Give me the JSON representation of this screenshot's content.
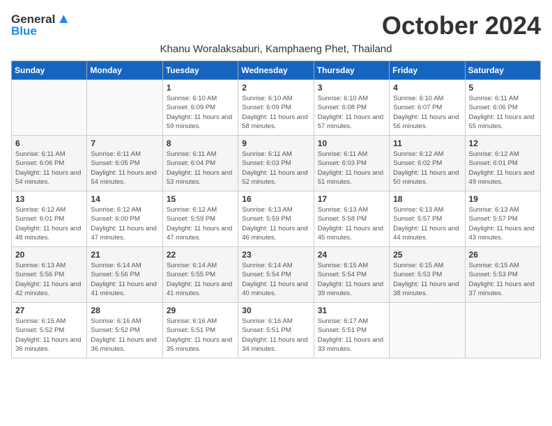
{
  "header": {
    "logo_general": "General",
    "logo_blue": "Blue",
    "month_title": "October 2024",
    "subtitle": "Khanu Woralaksaburi, Kamphaeng Phet, Thailand"
  },
  "weekdays": [
    "Sunday",
    "Monday",
    "Tuesday",
    "Wednesday",
    "Thursday",
    "Friday",
    "Saturday"
  ],
  "weeks": [
    [
      {
        "day": "",
        "sunrise": "",
        "sunset": "",
        "daylight": ""
      },
      {
        "day": "",
        "sunrise": "",
        "sunset": "",
        "daylight": ""
      },
      {
        "day": "1",
        "sunrise": "Sunrise: 6:10 AM",
        "sunset": "Sunset: 6:09 PM",
        "daylight": "Daylight: 11 hours and 59 minutes."
      },
      {
        "day": "2",
        "sunrise": "Sunrise: 6:10 AM",
        "sunset": "Sunset: 6:09 PM",
        "daylight": "Daylight: 11 hours and 58 minutes."
      },
      {
        "day": "3",
        "sunrise": "Sunrise: 6:10 AM",
        "sunset": "Sunset: 6:08 PM",
        "daylight": "Daylight: 11 hours and 57 minutes."
      },
      {
        "day": "4",
        "sunrise": "Sunrise: 6:10 AM",
        "sunset": "Sunset: 6:07 PM",
        "daylight": "Daylight: 11 hours and 56 minutes."
      },
      {
        "day": "5",
        "sunrise": "Sunrise: 6:11 AM",
        "sunset": "Sunset: 6:06 PM",
        "daylight": "Daylight: 11 hours and 55 minutes."
      }
    ],
    [
      {
        "day": "6",
        "sunrise": "Sunrise: 6:11 AM",
        "sunset": "Sunset: 6:06 PM",
        "daylight": "Daylight: 11 hours and 54 minutes."
      },
      {
        "day": "7",
        "sunrise": "Sunrise: 6:11 AM",
        "sunset": "Sunset: 6:05 PM",
        "daylight": "Daylight: 11 hours and 54 minutes."
      },
      {
        "day": "8",
        "sunrise": "Sunrise: 6:11 AM",
        "sunset": "Sunset: 6:04 PM",
        "daylight": "Daylight: 11 hours and 53 minutes."
      },
      {
        "day": "9",
        "sunrise": "Sunrise: 6:11 AM",
        "sunset": "Sunset: 6:03 PM",
        "daylight": "Daylight: 11 hours and 52 minutes."
      },
      {
        "day": "10",
        "sunrise": "Sunrise: 6:11 AM",
        "sunset": "Sunset: 6:03 PM",
        "daylight": "Daylight: 11 hours and 51 minutes."
      },
      {
        "day": "11",
        "sunrise": "Sunrise: 6:12 AM",
        "sunset": "Sunset: 6:02 PM",
        "daylight": "Daylight: 11 hours and 50 minutes."
      },
      {
        "day": "12",
        "sunrise": "Sunrise: 6:12 AM",
        "sunset": "Sunset: 6:01 PM",
        "daylight": "Daylight: 11 hours and 49 minutes."
      }
    ],
    [
      {
        "day": "13",
        "sunrise": "Sunrise: 6:12 AM",
        "sunset": "Sunset: 6:01 PM",
        "daylight": "Daylight: 11 hours and 48 minutes."
      },
      {
        "day": "14",
        "sunrise": "Sunrise: 6:12 AM",
        "sunset": "Sunset: 6:00 PM",
        "daylight": "Daylight: 11 hours and 47 minutes."
      },
      {
        "day": "15",
        "sunrise": "Sunrise: 6:12 AM",
        "sunset": "Sunset: 5:59 PM",
        "daylight": "Daylight: 11 hours and 47 minutes."
      },
      {
        "day": "16",
        "sunrise": "Sunrise: 6:13 AM",
        "sunset": "Sunset: 5:59 PM",
        "daylight": "Daylight: 11 hours and 46 minutes."
      },
      {
        "day": "17",
        "sunrise": "Sunrise: 6:13 AM",
        "sunset": "Sunset: 5:58 PM",
        "daylight": "Daylight: 11 hours and 45 minutes."
      },
      {
        "day": "18",
        "sunrise": "Sunrise: 6:13 AM",
        "sunset": "Sunset: 5:57 PM",
        "daylight": "Daylight: 11 hours and 44 minutes."
      },
      {
        "day": "19",
        "sunrise": "Sunrise: 6:13 AM",
        "sunset": "Sunset: 5:57 PM",
        "daylight": "Daylight: 11 hours and 43 minutes."
      }
    ],
    [
      {
        "day": "20",
        "sunrise": "Sunrise: 6:13 AM",
        "sunset": "Sunset: 5:56 PM",
        "daylight": "Daylight: 11 hours and 42 minutes."
      },
      {
        "day": "21",
        "sunrise": "Sunrise: 6:14 AM",
        "sunset": "Sunset: 5:56 PM",
        "daylight": "Daylight: 11 hours and 41 minutes."
      },
      {
        "day": "22",
        "sunrise": "Sunrise: 6:14 AM",
        "sunset": "Sunset: 5:55 PM",
        "daylight": "Daylight: 11 hours and 41 minutes."
      },
      {
        "day": "23",
        "sunrise": "Sunrise: 6:14 AM",
        "sunset": "Sunset: 5:54 PM",
        "daylight": "Daylight: 11 hours and 40 minutes."
      },
      {
        "day": "24",
        "sunrise": "Sunrise: 6:15 AM",
        "sunset": "Sunset: 5:54 PM",
        "daylight": "Daylight: 11 hours and 39 minutes."
      },
      {
        "day": "25",
        "sunrise": "Sunrise: 6:15 AM",
        "sunset": "Sunset: 5:53 PM",
        "daylight": "Daylight: 11 hours and 38 minutes."
      },
      {
        "day": "26",
        "sunrise": "Sunrise: 6:15 AM",
        "sunset": "Sunset: 5:53 PM",
        "daylight": "Daylight: 11 hours and 37 minutes."
      }
    ],
    [
      {
        "day": "27",
        "sunrise": "Sunrise: 6:15 AM",
        "sunset": "Sunset: 5:52 PM",
        "daylight": "Daylight: 11 hours and 36 minutes."
      },
      {
        "day": "28",
        "sunrise": "Sunrise: 6:16 AM",
        "sunset": "Sunset: 5:52 PM",
        "daylight": "Daylight: 11 hours and 36 minutes."
      },
      {
        "day": "29",
        "sunrise": "Sunrise: 6:16 AM",
        "sunset": "Sunset: 5:51 PM",
        "daylight": "Daylight: 11 hours and 35 minutes."
      },
      {
        "day": "30",
        "sunrise": "Sunrise: 6:16 AM",
        "sunset": "Sunset: 5:51 PM",
        "daylight": "Daylight: 11 hours and 34 minutes."
      },
      {
        "day": "31",
        "sunrise": "Sunrise: 6:17 AM",
        "sunset": "Sunset: 5:51 PM",
        "daylight": "Daylight: 11 hours and 33 minutes."
      },
      {
        "day": "",
        "sunrise": "",
        "sunset": "",
        "daylight": ""
      },
      {
        "day": "",
        "sunrise": "",
        "sunset": "",
        "daylight": ""
      }
    ]
  ]
}
